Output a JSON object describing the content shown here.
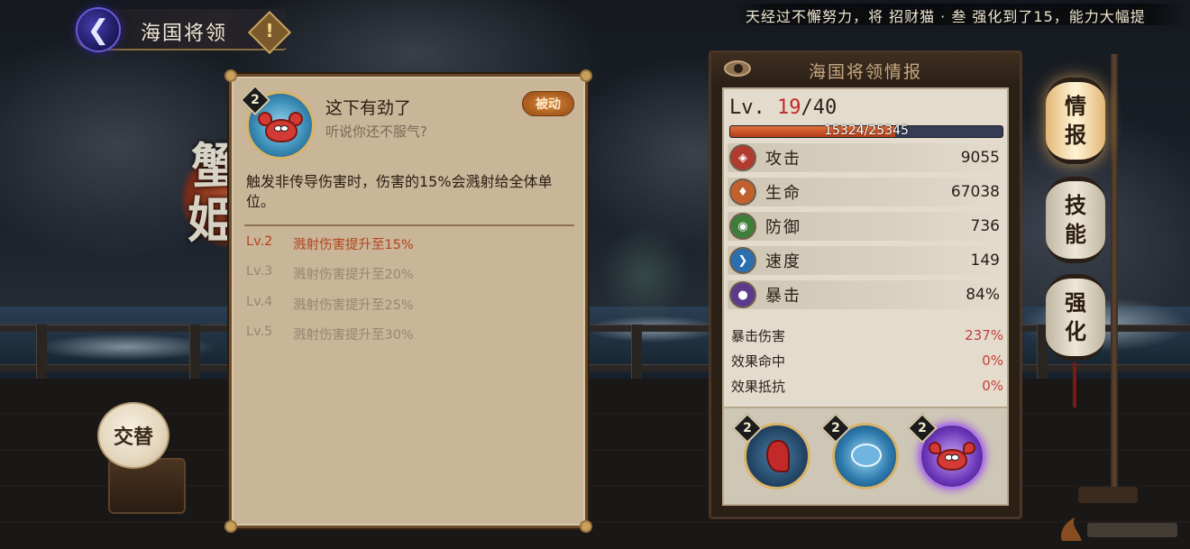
{
  "header": {
    "title": "海国将领",
    "back_icon": "chevron-left-icon",
    "info_icon": "exclamation-icon",
    "info_label": "!"
  },
  "marquee": {
    "text": "天经过不懈努力，将 招财猫 · 叁 强化到了15，能力大幅提"
  },
  "swap_button": {
    "label": "交替"
  },
  "skill_panel": {
    "level_badge": "2",
    "name": "这下有劲了",
    "subtitle": "听说你还不服气?",
    "tag": "被动",
    "description": "触发非传导伤害时，伤害的15%会溅射给全体单位。",
    "levels": [
      {
        "lv": "Lv.2",
        "text": "溅射伤害提升至15%",
        "active": true
      },
      {
        "lv": "Lv.3",
        "text": "溅射伤害提升至20%",
        "active": false
      },
      {
        "lv": "Lv.4",
        "text": "溅射伤害提升至25%",
        "active": false
      },
      {
        "lv": "Lv.5",
        "text": "溅射伤害提升至30%",
        "active": false
      }
    ]
  },
  "info_panel": {
    "title": "海国将领情报",
    "level_prefix": "Lv. ",
    "level_current": "19",
    "level_max": "/40",
    "exp_text": "15324/25345",
    "exp_fraction": 0.605,
    "stats": [
      {
        "name": "攻击",
        "value": "9055",
        "icon": "attack-fan-icon",
        "color": "#b23a2f"
      },
      {
        "name": "生命",
        "value": "67038",
        "icon": "health-card-icon",
        "color": "#c0612e"
      },
      {
        "name": "防御",
        "value": "736",
        "icon": "defense-mask-icon",
        "color": "#3e7d3a"
      },
      {
        "name": "速度",
        "value": "149",
        "icon": "speed-chevron-icon",
        "color": "#2a6fb0"
      },
      {
        "name": "暴击",
        "value": "84%",
        "icon": "crit-card-icon",
        "color": "#5b3a8c"
      }
    ],
    "sub_stats": [
      {
        "name": "暴击伤害",
        "value": "237%"
      },
      {
        "name": "效果命中",
        "value": "0%"
      },
      {
        "name": "效果抵抗",
        "value": "0%"
      }
    ],
    "skill_slots": [
      {
        "badge": "2",
        "icon": "red-claw-skill-icon",
        "selected": false
      },
      {
        "badge": "2",
        "icon": "blue-crab-skill-icon",
        "selected": false
      },
      {
        "badge": "2",
        "icon": "red-crab-skill-icon",
        "selected": true
      }
    ]
  },
  "side_tabs": [
    {
      "label_top": "情",
      "label_bottom": "报",
      "active": true
    },
    {
      "label_top": "技",
      "label_bottom": "能",
      "active": false
    },
    {
      "label_top": "强",
      "label_bottom": "化",
      "active": false
    }
  ],
  "background": {
    "glyph_1": "蟹",
    "glyph_2": "姫"
  },
  "colors": {
    "panel_parchment": "#c9b598",
    "active_level_text": "#b4451e",
    "inactive_level_text": "#988670",
    "exp_fill": "#c44a22",
    "sub_stat_value": "#c63c3c"
  }
}
